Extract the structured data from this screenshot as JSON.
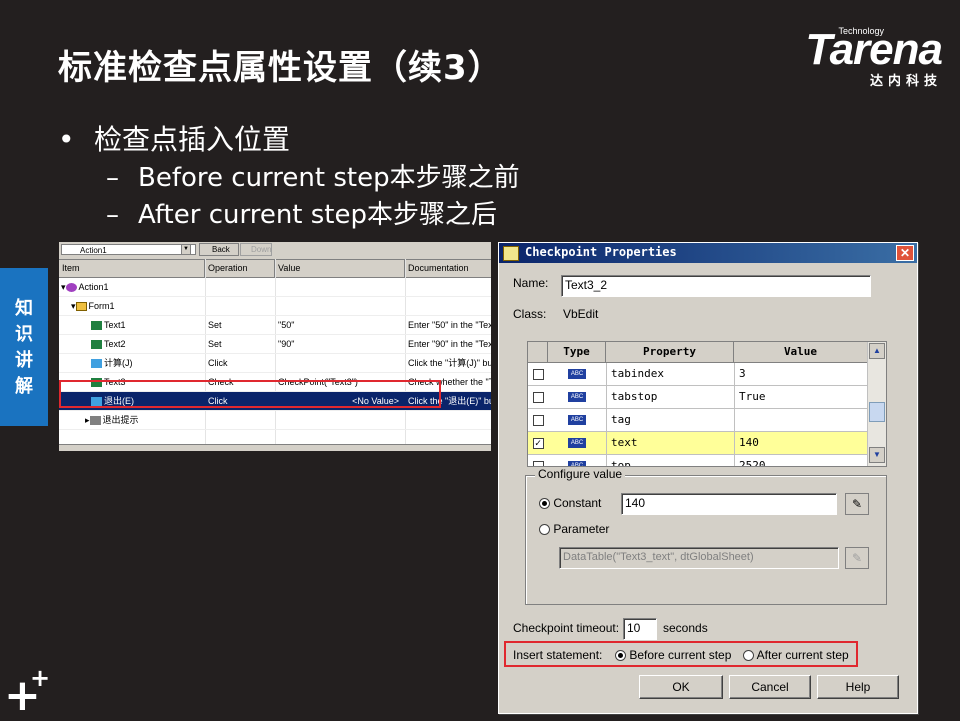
{
  "slide": {
    "title": "标准检查点属性设置（续3）",
    "side_tab": "知识讲解",
    "logo": {
      "tech": "Technology",
      "main": "Tarena",
      "cn": "达内科技"
    },
    "bullets": {
      "main": "检查点插入位置",
      "sub1": "Before current step本步骤之前",
      "sub2": "After current step本步骤之后"
    }
  },
  "keyword_view": {
    "combo": "Action1",
    "back": "Back",
    "forward": "Down",
    "columns": [
      "Item",
      "Operation",
      "Value",
      "Documentation"
    ],
    "rows": [
      {
        "item": "Action1",
        "op": "",
        "val": "",
        "doc": ""
      },
      {
        "item": "Form1",
        "op": "",
        "val": "",
        "doc": ""
      },
      {
        "item": "Text1",
        "op": "Set",
        "val": "\"50\"",
        "doc": "Enter \"50\" in the \"Text1\" e"
      },
      {
        "item": "Text2",
        "op": "Set",
        "val": "\"90\"",
        "doc": "Enter \"90\" in the \"Text2\" e"
      },
      {
        "item": "计算(J)",
        "op": "Click",
        "val": "",
        "doc": "Click the \"计算(J)\" button."
      },
      {
        "item": "Text3",
        "op": "Check",
        "val": "CheckPoint(\"Text3\")",
        "doc": "Check whether the \"Text3\""
      },
      {
        "item": "退出(E)",
        "op": "Click",
        "val": "",
        "extra": "<No Value>",
        "doc": "Click the \"退出(E)\" button."
      },
      {
        "item": "退出提示",
        "op": "",
        "val": "",
        "doc": ""
      }
    ]
  },
  "dialog": {
    "title": "Checkpoint Properties",
    "name_label": "Name:",
    "name_value": "Text3_2",
    "class_label": "Class:",
    "class_value": "VbEdit",
    "grid_headers": [
      "Type",
      "Property",
      "Value"
    ],
    "grid_rows": [
      {
        "checked": false,
        "type": "ABC",
        "prop": "tabindex",
        "val": "3"
      },
      {
        "checked": false,
        "type": "ABC",
        "prop": "tabstop",
        "val": "True"
      },
      {
        "checked": false,
        "type": "ABC",
        "prop": "tag",
        "val": ""
      },
      {
        "checked": true,
        "type": "ABC",
        "prop": "text",
        "val": "140"
      },
      {
        "checked": false,
        "type": "ABC",
        "prop": "top",
        "val": "2520"
      }
    ],
    "configure_label": "Configure value",
    "constant_label": "Constant",
    "constant_value": "140",
    "parameter_label": "Parameter",
    "parameter_value": "DataTable(\"Text3_text\", dtGlobalSheet)",
    "timeout_label": "Checkpoint timeout:",
    "timeout_value": "10",
    "seconds_label": "seconds",
    "insert_label": "Insert statement:",
    "before_label": "Before current step",
    "after_label": "After current step",
    "ok": "OK",
    "cancel": "Cancel",
    "help": "Help"
  }
}
